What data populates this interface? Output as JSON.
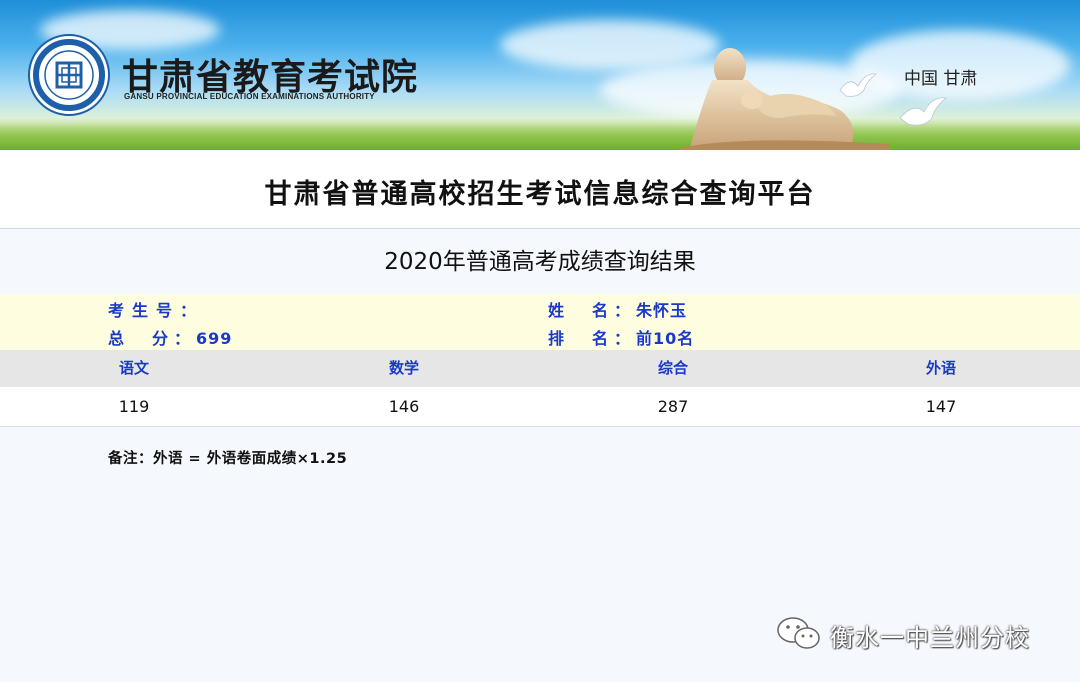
{
  "header": {
    "org_name_cn": "甘肃省教育考试院",
    "org_name_en": "GANSU PROVINCIAL EDUCATION EXAMINATIONS AUTHORITY",
    "region": "中国  甘肃",
    "logo_icon": "emblem-icon",
    "colors": {
      "sky": "#4ab0ec",
      "grass": "#8cc34a"
    }
  },
  "platform_title": "甘肃省普通高校招生考试信息综合查询平台",
  "result_title": "2020年普通高考成绩查询结果",
  "student": {
    "exam_no_label": "考生号：",
    "exam_no_value": "",
    "name_label": "姓　名：",
    "name_value": "朱怀玉",
    "total_label": "总　分：",
    "total_value": "699",
    "rank_label": "排　名：",
    "rank_value": "前10名"
  },
  "scores": {
    "columns": [
      "语文",
      "数学",
      "综合",
      "外语"
    ],
    "values": [
      "119",
      "146",
      "287",
      "147"
    ]
  },
  "note": "备注：外语 = 外语卷面成绩×1.25",
  "watermark": {
    "text": "衡水一中兰州分校",
    "icon": "wechat-icon"
  },
  "colors": {
    "label_blue": "#1a39c9",
    "info_bg": "#fffde0",
    "header_row_bg": "#e6e6e6",
    "page_bg": "#f5f8fd"
  }
}
